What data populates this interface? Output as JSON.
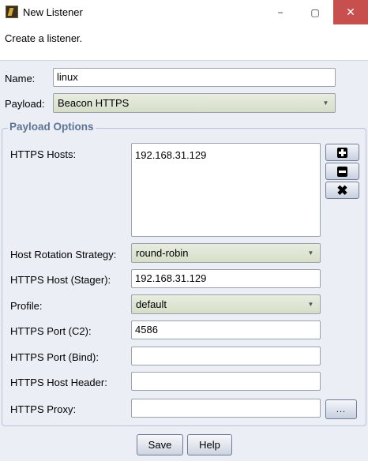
{
  "window": {
    "title": "New Listener",
    "minimize": "−",
    "maximize": "▢",
    "close": "✕"
  },
  "intro": "Create a listener.",
  "form": {
    "name_label": "Name:",
    "name_value": "linux",
    "payload_label": "Payload:",
    "payload_value": "Beacon HTTPS"
  },
  "payload_options": {
    "title": "Payload Options",
    "https_hosts_label": "HTTPS Hosts:",
    "https_hosts": [
      "192.168.31.129"
    ],
    "host_rotation_label": "Host Rotation Strategy:",
    "host_rotation_value": "round-robin",
    "stager_label": "HTTPS Host (Stager):",
    "stager_value": "192.168.31.129",
    "profile_label": "Profile:",
    "profile_value": "default",
    "port_c2_label": "HTTPS Port (C2):",
    "port_c2_value": "4586",
    "port_bind_label": "HTTPS Port (Bind):",
    "port_bind_value": "",
    "host_header_label": "HTTPS Host Header:",
    "host_header_value": "",
    "proxy_label": "HTTPS Proxy:",
    "proxy_value": "",
    "proxy_button": "..."
  },
  "buttons": {
    "save": "Save",
    "help": "Help"
  },
  "icons": {
    "add": "plus-square-icon",
    "remove": "minus-square-icon",
    "clear": "x-icon",
    "dropdown": "chevron-down-icon"
  }
}
